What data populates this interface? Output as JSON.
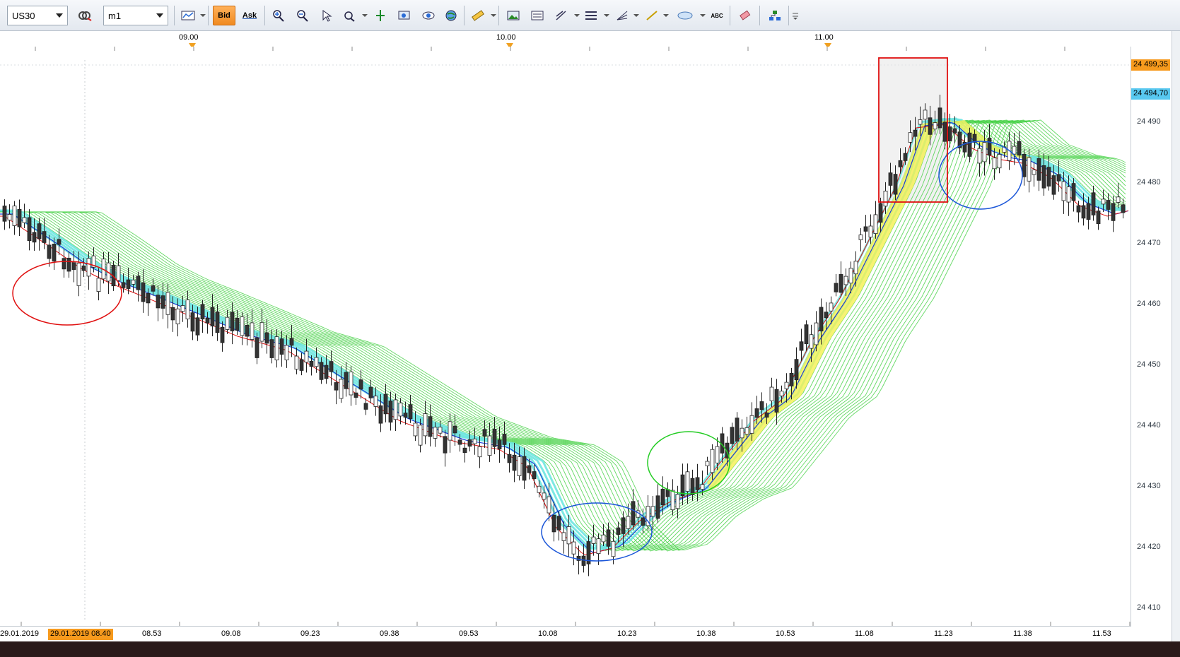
{
  "toolbar": {
    "symbol": "US30",
    "timeframe": "m1",
    "bid_label": "Bid",
    "ask_label": "Ask",
    "text_tool_label": "ABC"
  },
  "date_header": {
    "labels": [
      "09.00",
      "10.00",
      "11.00"
    ]
  },
  "price_axis": {
    "labels": [
      "24 490",
      "24 480",
      "24 470",
      "24 460",
      "24 450",
      "24 440",
      "24 430",
      "24 420",
      "24 410"
    ],
    "bid_tag": "24 499,35",
    "ask_tag": "24 494,70",
    "bid_color": "#f79a1d",
    "ask_color": "#58c8f0"
  },
  "time_axis": {
    "start_label": "29.01.2019",
    "cursor_tag": "29.01.2019 08.40",
    "labels": [
      "08.53",
      "09.08",
      "09.23",
      "09.38",
      "09.53",
      "10.08",
      "10.23",
      "10.38",
      "10.53",
      "11.08",
      "11.23",
      "11.38",
      "11.53"
    ]
  },
  "colors": {
    "candle_bull": "#ffffff",
    "candle_bear": "#333333",
    "ema_fast": "#e01010",
    "ema_mid": "#1a3fd8",
    "ribbon_green": "#33cc33",
    "ribbon_cyan": "#6ee6e0",
    "ribbon_yellow": "#f5f050",
    "annotation_red": "#e01010",
    "annotation_blue": "#1a55d8",
    "annotation_green": "#22cc22"
  }
}
